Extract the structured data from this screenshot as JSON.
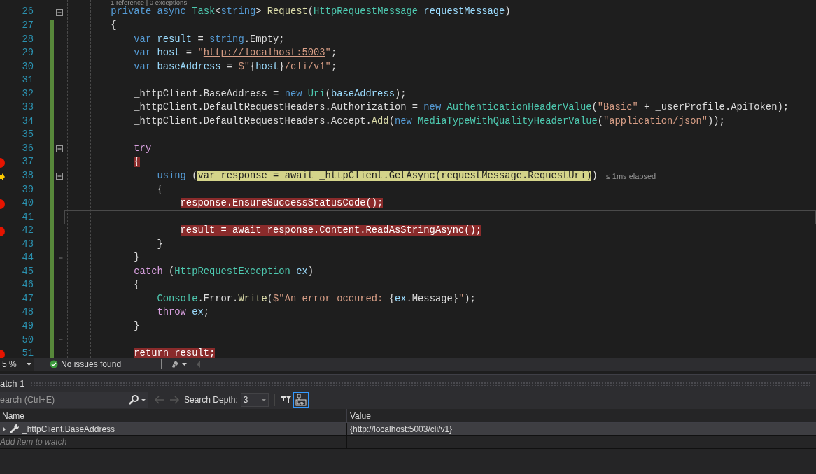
{
  "editor": {
    "codelens": "1 reference | 0 exceptions",
    "lines": [
      {
        "number": "26",
        "changed": false,
        "fold_start": true,
        "tokens": [
          {
            "kind": "kw",
            "text": "private async"
          },
          {
            "kind": "type",
            "text": " Task"
          },
          {
            "kind": "plain",
            "text": "<"
          },
          {
            "kind": "kw",
            "text": "string"
          },
          {
            "kind": "plain",
            "text": "> "
          },
          {
            "kind": "fn",
            "text": "Request"
          },
          {
            "kind": "plain",
            "text": "("
          },
          {
            "kind": "type",
            "text": "HttpRequestMessage"
          },
          {
            "kind": "var",
            "text": " requestMessage"
          },
          {
            "kind": "plain",
            "text": ")"
          }
        ]
      },
      {
        "number": "27",
        "changed": true,
        "tokens": [
          {
            "kind": "plain",
            "text": "{"
          }
        ],
        "children": [
          {
            "number": "28",
            "changed": true,
            "tokens": [
              {
                "kind": "kw",
                "text": "var"
              },
              {
                "kind": "var",
                "text": " result"
              },
              {
                "kind": "plain",
                "text": " = "
              },
              {
                "kind": "kw",
                "text": "string"
              },
              {
                "kind": "plain",
                "text": ".Empty;"
              }
            ]
          },
          {
            "number": "29",
            "changed": true,
            "tokens": [
              {
                "kind": "kw",
                "text": "var"
              },
              {
                "kind": "var",
                "text": " host"
              },
              {
                "kind": "plain",
                "text": " = "
              },
              {
                "kind": "str",
                "text": "\""
              },
              {
                "kind": "url",
                "text": "http://localhost:5003"
              },
              {
                "kind": "str",
                "text": "\""
              },
              {
                "kind": "plain",
                "text": ";"
              }
            ]
          },
          {
            "number": "30",
            "changed": true,
            "tokens": [
              {
                "kind": "kw",
                "text": "var"
              },
              {
                "kind": "var",
                "text": " baseAddress"
              },
              {
                "kind": "plain",
                "text": " = "
              },
              {
                "kind": "str",
                "text": "$\""
              },
              {
                "kind": "plain",
                "text": "{"
              },
              {
                "kind": "var",
                "text": "host"
              },
              {
                "kind": "plain",
                "text": "}"
              },
              {
                "kind": "str",
                "text": "/cli/v1\""
              },
              {
                "kind": "plain",
                "text": ";"
              }
            ]
          },
          {
            "number": "31",
            "changed": true
          },
          {
            "number": "32",
            "changed": true,
            "tokens": [
              {
                "kind": "plain",
                "text": "_httpClient.BaseAddress = "
              },
              {
                "kind": "kw",
                "text": "new"
              },
              {
                "kind": "type",
                "text": " Uri"
              },
              {
                "kind": "plain",
                "text": "("
              },
              {
                "kind": "var",
                "text": "baseAddress"
              },
              {
                "kind": "plain",
                "text": ");"
              }
            ]
          },
          {
            "number": "33",
            "changed": true,
            "tokens": [
              {
                "kind": "plain",
                "text": "_httpClient.DefaultRequestHeaders.Authorization = "
              },
              {
                "kind": "kw",
                "text": "new"
              },
              {
                "kind": "type",
                "text": " AuthenticationHeaderValue"
              },
              {
                "kind": "plain",
                "text": "("
              },
              {
                "kind": "str",
                "text": "\"Basic\""
              },
              {
                "kind": "plain",
                "text": " + _userProfile.ApiToken);"
              }
            ]
          },
          {
            "number": "34",
            "changed": true,
            "tokens": [
              {
                "kind": "plain",
                "text": "_httpClient.DefaultRequestHeaders.Accept."
              },
              {
                "kind": "fn",
                "text": "Add"
              },
              {
                "kind": "plain",
                "text": "("
              },
              {
                "kind": "kw",
                "text": "new"
              },
              {
                "kind": "type",
                "text": " MediaTypeWithQualityHeaderValue"
              },
              {
                "kind": "plain",
                "text": "("
              },
              {
                "kind": "str",
                "text": "\"application/json\""
              },
              {
                "kind": "plain",
                "text": "));"
              }
            ]
          },
          {
            "number": "35",
            "changed": true
          },
          {
            "number": "36",
            "changed": true,
            "fold_start": true,
            "tokens": [
              {
                "kind": "ctl",
                "text": "try"
              }
            ]
          },
          {
            "number": "37",
            "changed": true,
            "breakpoint": true,
            "tokens": [
              {
                "text": "{",
                "breakpoint_hit": true
              }
            ],
            "children": [
              {
                "number": "38",
                "changed": true,
                "current": true,
                "fold_start": true,
                "tokens": [
                  {
                    "kind": "kw",
                    "text": "using"
                  },
                  {
                    "kind": "plain",
                    "text": " ("
                  },
                  {
                    "text": "var response = await _httpClient.GetAsync(requestMessage.RequestUri)",
                    "current_statement": true
                  },
                  {
                    "kind": "plain",
                    "text": ")"
                  }
                ],
                "hint": "≤ 1ms elapsed"
              },
              {
                "number": "39",
                "changed": true,
                "tokens": [
                  {
                    "kind": "plain",
                    "text": "{"
                  }
                ],
                "children": [
                  {
                    "number": "40",
                    "changed": true,
                    "breakpoint": true,
                    "tokens": [
                      {
                        "text": "response.EnsureSuccessStatusCode();",
                        "breakpoint_hit": true
                      }
                    ]
                  },
                  {
                    "number": "41",
                    "changed": true,
                    "caret_line": true
                  },
                  {
                    "number": "42",
                    "changed": true,
                    "breakpoint": true,
                    "tokens": [
                      {
                        "text": "result = await response.Content.ReadAsStringAsync();",
                        "breakpoint_hit": true
                      }
                    ]
                  }
                ]
              },
              {
                "number": "43",
                "changed": true,
                "tokens": [
                  {
                    "kind": "plain",
                    "text": "}"
                  }
                ]
              }
            ]
          },
          {
            "number": "44",
            "changed": true,
            "fold_end": true,
            "tokens": [
              {
                "kind": "plain",
                "text": "}"
              }
            ]
          },
          {
            "number": "45",
            "changed": true,
            "tokens": [
              {
                "kind": "ctl",
                "text": "catch"
              },
              {
                "kind": "plain",
                "text": " ("
              },
              {
                "kind": "type",
                "text": "HttpRequestException"
              },
              {
                "kind": "var",
                "text": " ex"
              },
              {
                "kind": "plain",
                "text": ")"
              }
            ]
          },
          {
            "number": "46",
            "changed": true,
            "tokens": [
              {
                "kind": "plain",
                "text": "{"
              }
            ],
            "children": [
              {
                "number": "47",
                "changed": true,
                "tokens": [
                  {
                    "kind": "type",
                    "text": "Console"
                  },
                  {
                    "kind": "plain",
                    "text": ".Error."
                  },
                  {
                    "kind": "fn",
                    "text": "Write"
                  },
                  {
                    "kind": "plain",
                    "text": "("
                  },
                  {
                    "kind": "str",
                    "text": "$\"An error occured: "
                  },
                  {
                    "kind": "plain",
                    "text": "{"
                  },
                  {
                    "kind": "var",
                    "text": "ex"
                  },
                  {
                    "kind": "plain",
                    "text": ".Message}"
                  },
                  {
                    "kind": "str",
                    "text": "\""
                  },
                  {
                    "kind": "plain",
                    "text": ");"
                  }
                ]
              },
              {
                "number": "48",
                "changed": true,
                "tokens": [
                  {
                    "kind": "ctl",
                    "text": "throw"
                  },
                  {
                    "kind": "var",
                    "text": " ex"
                  },
                  {
                    "kind": "plain",
                    "text": ";"
                  }
                ]
              }
            ]
          },
          {
            "number": "49",
            "changed": true,
            "tokens": [
              {
                "kind": "plain",
                "text": "}"
              }
            ]
          },
          {
            "number": "50",
            "changed": true,
            "fold_end": true
          },
          {
            "number": "51",
            "changed": true,
            "breakpoint": true,
            "tokens": [
              {
                "text": "return result;",
                "breakpoint_hit": true
              }
            ]
          }
        ]
      }
    ]
  },
  "status_bar": {
    "zoom": "5 %",
    "issues": "No issues found"
  },
  "watch": {
    "title": "atch 1",
    "search_placeholder": "earch (Ctrl+E)",
    "depth_label": "Search Depth:",
    "depth": "3",
    "toggles": [
      {
        "kind": "pin-filter",
        "selected": false
      },
      {
        "kind": "tab-view",
        "selected": true
      }
    ],
    "columns": [
      "Name",
      "Value"
    ],
    "rows": [
      {
        "name": "_httpClient.BaseAddress",
        "value": "{http://localhost:5003/cli/v1}",
        "expanded": false,
        "selected": true
      }
    ],
    "add_placeholder": "Add item to watch"
  }
}
